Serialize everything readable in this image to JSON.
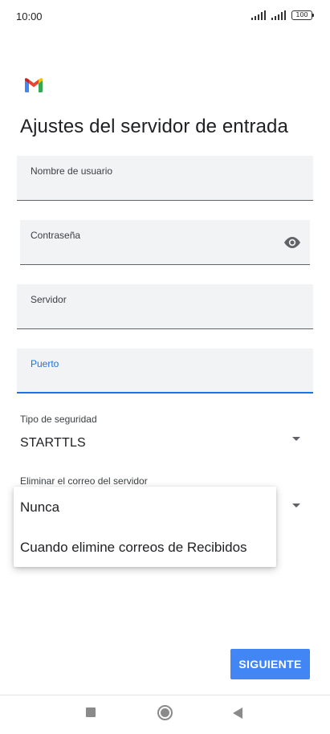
{
  "status_bar": {
    "time": "10:00",
    "battery": "100"
  },
  "header": {
    "logo": "gmail-logo",
    "title": "Ajustes del servidor de entrada"
  },
  "form": {
    "username_label": "Nombre de usuario",
    "username_value": "",
    "password_label": "Contraseña",
    "password_value": "",
    "server_label": "Servidor",
    "server_value": "",
    "port_label": "Puerto",
    "port_value": "",
    "security_label": "Tipo de seguridad",
    "security_value": "STARTTLS",
    "delete_label": "Eliminar el correo del servidor"
  },
  "dropdown": {
    "options": [
      "Nunca",
      "Cuando elimine correos de Recibidos"
    ]
  },
  "actions": {
    "next_label": "SIGUIENTE"
  },
  "colors": {
    "accent": "#1a73e8",
    "button": "#4285f4",
    "field_bg": "#f1f3f4"
  }
}
